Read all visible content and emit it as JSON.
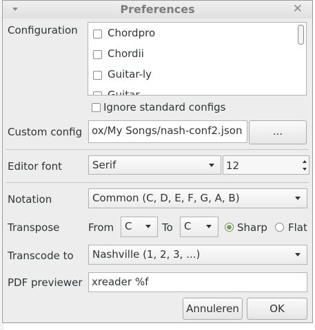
{
  "dialog": {
    "title": "Preferences"
  },
  "configuration": {
    "label": "Configuration",
    "items": [
      {
        "label": "Chordpro",
        "checked": false
      },
      {
        "label": "Chordii",
        "checked": false
      },
      {
        "label": "Guitar-ly",
        "checked": false
      },
      {
        "label": "Guitar",
        "checked": false
      }
    ],
    "ignore_label": "Ignore standard configs",
    "ignore_checked": false
  },
  "custom_config": {
    "label": "Custom config",
    "value": "ox/My Songs/nash-conf2.json",
    "browse_label": "..."
  },
  "editor_font": {
    "label": "Editor font",
    "family": "Serif",
    "size": "12"
  },
  "notation": {
    "label": "Notation",
    "value": "Common (C, D, E, F, G, A, B)"
  },
  "transpose": {
    "label": "Transpose",
    "from_label": "From",
    "from_value": "C",
    "to_label": "To",
    "to_value": "C",
    "sharp_label": "Sharp",
    "flat_label": "Flat",
    "selected": "Sharp"
  },
  "transcode": {
    "label": "Transcode to",
    "value": "Nashville (1, 2, 3, ...)"
  },
  "pdf_previewer": {
    "label": "PDF previewer",
    "value": "xreader %f"
  },
  "buttons": {
    "cancel": "Annuleren",
    "ok": "OK"
  },
  "colors": {
    "dialog_bg": "#ededed",
    "radio_selected": "#7ea05d"
  }
}
